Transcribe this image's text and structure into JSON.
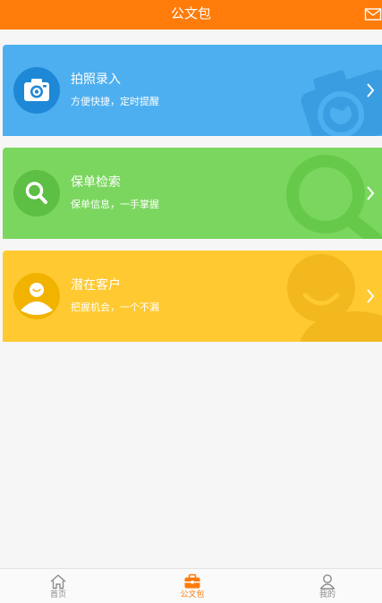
{
  "header": {
    "title": "公文包",
    "right_icon": "mail-icon",
    "color": "#ff7b0a"
  },
  "cards": [
    {
      "title": "拍照录入",
      "subtitle": "方便快捷，定时提醒",
      "icon": "camera-icon",
      "color": "#4dafef"
    },
    {
      "title": "保单检索",
      "subtitle": "保单信息，一手掌握",
      "icon": "search-icon",
      "color": "#7bd65f"
    },
    {
      "title": "潜在客户",
      "subtitle": "把握机会，一个不漏",
      "icon": "user-icon",
      "color": "#ffc931"
    }
  ],
  "tabbar": {
    "items": [
      {
        "label": "首页",
        "icon": "home-icon",
        "active": false
      },
      {
        "label": "公文包",
        "icon": "briefcase-icon",
        "active": true
      },
      {
        "label": "我的",
        "icon": "person-icon",
        "active": false
      }
    ],
    "active_color": "#ff7b0a",
    "inactive_color": "#8a8a8a"
  }
}
